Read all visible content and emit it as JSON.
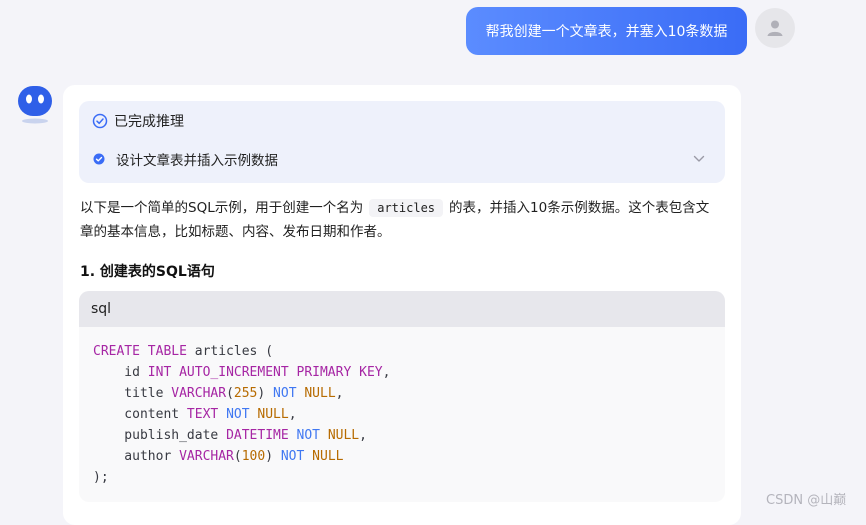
{
  "user_message": "帮我创建一个文章表，并塞入10条数据",
  "reasoning": {
    "status": "已完成推理",
    "step": "设计文章表并插入示例数据"
  },
  "answer": {
    "intro_before": "以下是一个简单的SQL示例，用于创建一个名为",
    "intro_code": "articles",
    "intro_after": "的表，并插入10条示例数据。这个表包含文章的基本信息，比如标题、内容、发布日期和作者。",
    "section_title": "1. 创建表的SQL语句",
    "code_lang": "sql",
    "code_lines": [
      [
        {
          "t": "CREATE TABLE",
          "c": "kw"
        },
        {
          "t": " articles (",
          "c": ""
        }
      ],
      [
        {
          "t": "    id ",
          "c": ""
        },
        {
          "t": "INT AUTO_INCREMENT PRIMARY KEY",
          "c": "kw"
        },
        {
          "t": ",",
          "c": ""
        }
      ],
      [
        {
          "t": "    title ",
          "c": ""
        },
        {
          "t": "VARCHAR",
          "c": "kw"
        },
        {
          "t": "(",
          "c": ""
        },
        {
          "t": "255",
          "c": "num"
        },
        {
          "t": ") ",
          "c": ""
        },
        {
          "t": "NOT",
          "c": "not"
        },
        {
          "t": " ",
          "c": ""
        },
        {
          "t": "NULL",
          "c": "lit"
        },
        {
          "t": ",",
          "c": ""
        }
      ],
      [
        {
          "t": "    content ",
          "c": ""
        },
        {
          "t": "TEXT",
          "c": "kw"
        },
        {
          "t": " ",
          "c": ""
        },
        {
          "t": "NOT",
          "c": "not"
        },
        {
          "t": " ",
          "c": ""
        },
        {
          "t": "NULL",
          "c": "lit"
        },
        {
          "t": ",",
          "c": ""
        }
      ],
      [
        {
          "t": "    publish_date ",
          "c": ""
        },
        {
          "t": "DATETIME",
          "c": "kw"
        },
        {
          "t": " ",
          "c": ""
        },
        {
          "t": "NOT",
          "c": "not"
        },
        {
          "t": " ",
          "c": ""
        },
        {
          "t": "NULL",
          "c": "lit"
        },
        {
          "t": ",",
          "c": ""
        }
      ],
      [
        {
          "t": "    author ",
          "c": ""
        },
        {
          "t": "VARCHAR",
          "c": "kw"
        },
        {
          "t": "(",
          "c": ""
        },
        {
          "t": "100",
          "c": "num"
        },
        {
          "t": ") ",
          "c": ""
        },
        {
          "t": "NOT",
          "c": "not"
        },
        {
          "t": " ",
          "c": ""
        },
        {
          "t": "NULL",
          "c": "lit"
        }
      ],
      [
        {
          "t": ");",
          "c": ""
        }
      ]
    ]
  },
  "watermark": "CSDN @山巅",
  "icons": {
    "user_avatar": "user-silhouette-icon",
    "bot_avatar": "robot-face-icon",
    "reason_done": "check-circle-icon",
    "step_done": "check-dot-icon",
    "expand": "chevron-down-icon"
  },
  "colors": {
    "accent": "#3a6cf6",
    "page_bg": "#f4f4f9",
    "reason_bg": "#eef1fb"
  }
}
